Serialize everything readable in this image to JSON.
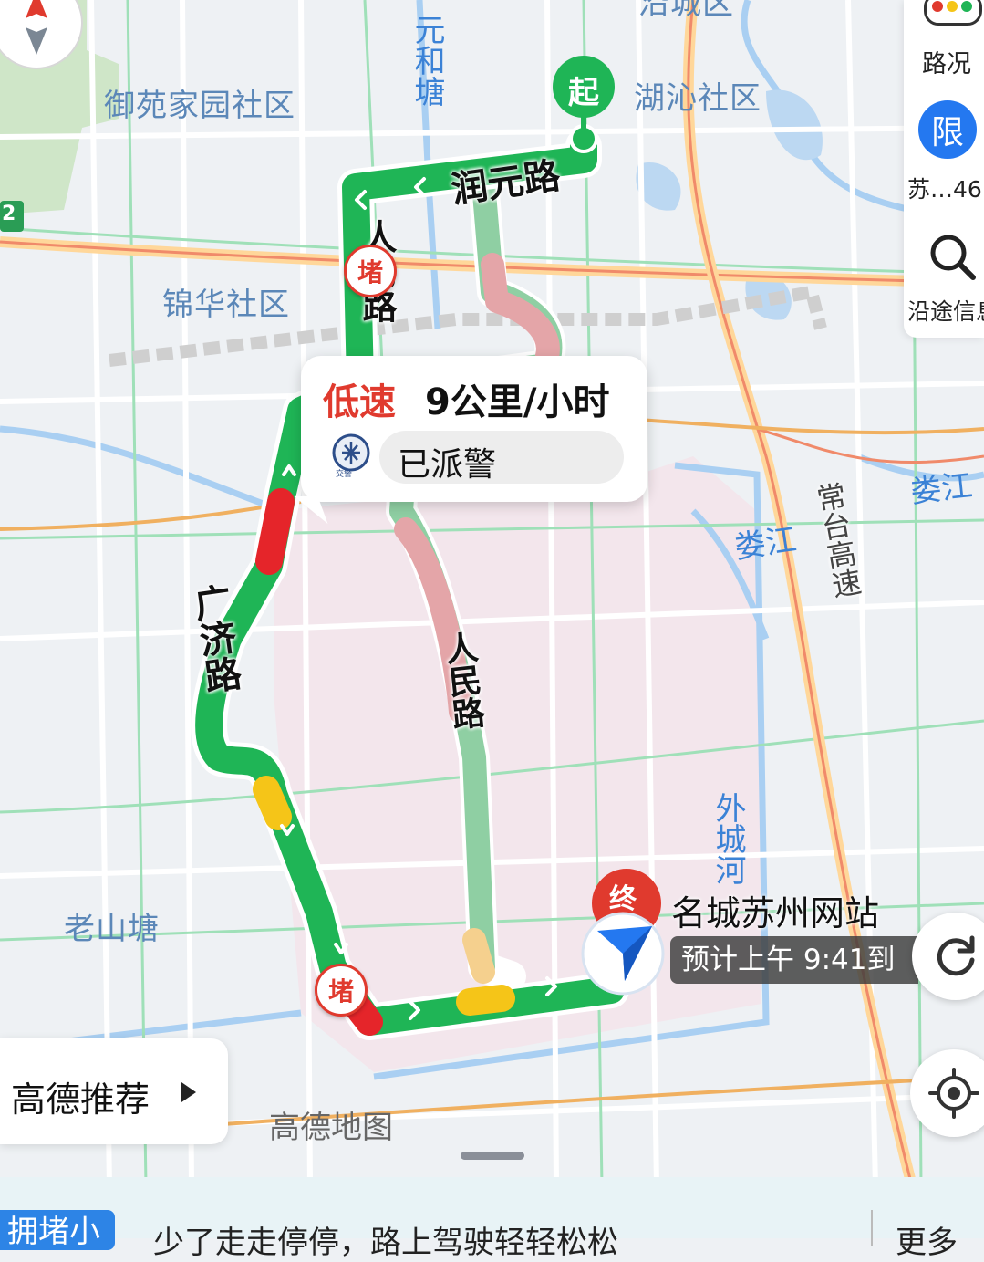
{
  "map": {
    "districts": [
      "御苑家园社区",
      "湖沁社区",
      "锦华社区",
      "老山塘"
    ],
    "water_labels": [
      "元和塘",
      "娄江",
      "娄江",
      "外城河"
    ],
    "road_labels": [
      "润元路",
      "人民路",
      "广济路",
      "人民路",
      "常台高速"
    ],
    "partial_top_label": "沿城区",
    "watermark": "高德地图",
    "highway_badge": "2"
  },
  "route": {
    "start_label": "起",
    "end_label": "终",
    "jam_badges": [
      "堵",
      "堵"
    ],
    "destination_name": "名城苏州网站",
    "eta_text": "预计上午 9:41到"
  },
  "popup": {
    "speed_status": "低速",
    "speed_value": "9公里/小时",
    "dispatch_status": "已派警",
    "police_logo_text": "交警"
  },
  "sidebar": {
    "traffic_label": "路况",
    "restriction_icon_label": "限",
    "restriction_text": "苏…46",
    "search_along_label": "沿途信息"
  },
  "bottom": {
    "recommend_label": "高德推荐",
    "tag_text": "拥堵小",
    "ticker_text": "少了走走停停，路上驾驶轻轻松松",
    "more_label": "更多"
  },
  "colors": {
    "route_green": "#1fb556",
    "route_red": "#e5252a",
    "route_yellow": "#f5c518",
    "accent_blue": "#2478f0",
    "jam_red": "#e03a2e"
  }
}
